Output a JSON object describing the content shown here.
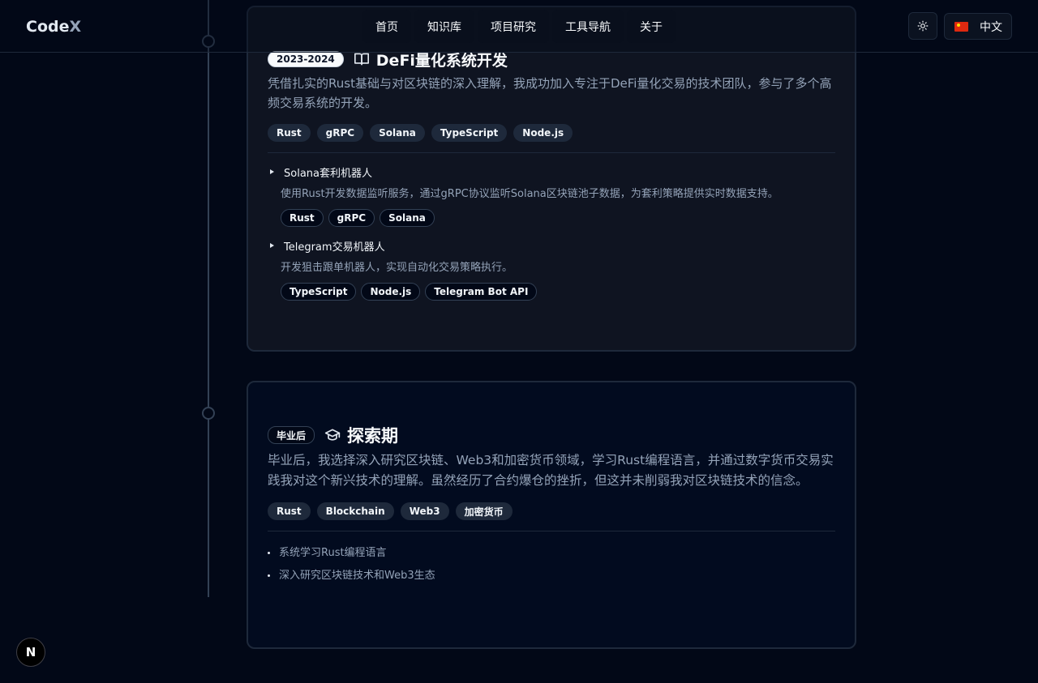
{
  "header": {
    "logo_main": "Code",
    "logo_accent": "X",
    "nav": [
      "首页",
      "知识库",
      "项目研究",
      "工具导航",
      "关于"
    ],
    "theme_icon": "sun-icon",
    "language": {
      "label": "中文",
      "flag": "china-flag-icon"
    }
  },
  "timeline": {
    "card1": {
      "period": "2023-2024",
      "icon": "book-open-icon",
      "title": "DeFi量化系统开发",
      "description": "凭借扎实的Rust基础与对区块链的深入理解，我成功加入专注于DeFi量化交易的技术团队，参与了多个高频交易系统的开发。",
      "tags": [
        "Rust",
        "gRPC",
        "Solana",
        "TypeScript",
        "Node.js"
      ],
      "projects": [
        {
          "name": "Solana套利机器人",
          "description": "使用Rust开发数据监听服务，通过gRPC协议监听Solana区块链池子数据，为套利策略提供实时数据支持。",
          "tags": [
            "Rust",
            "gRPC",
            "Solana"
          ]
        },
        {
          "name": "Telegram交易机器人",
          "description": "开发狙击跟单机器人，实现自动化交易策略执行。",
          "tags": [
            "TypeScript",
            "Node.js",
            "Telegram Bot API"
          ]
        }
      ]
    },
    "card2": {
      "period": "毕业后",
      "icon": "graduation-cap-icon",
      "title": "探索期",
      "description": "毕业后，我选择深入研究区块链、Web3和加密货币领域，学习Rust编程语言，并通过数字货币交易实践我对这个新兴技术的理解。虽然经历了合约爆仓的挫折，但这并未削弱我对区块链技术的信念。",
      "tags": [
        "Rust",
        "Blockchain",
        "Web3",
        "加密货币"
      ],
      "highlights": [
        "系统学习Rust编程语言",
        "深入研究区块链技术和Web3生态"
      ]
    }
  },
  "dev_badge": "N"
}
